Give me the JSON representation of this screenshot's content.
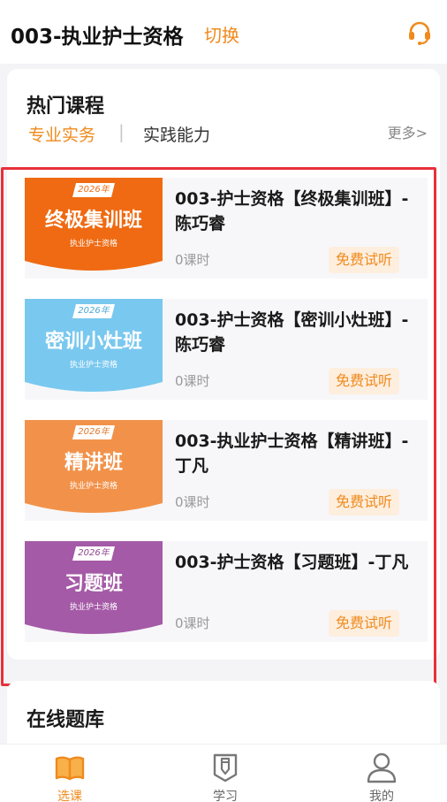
{
  "header": {
    "title": "003-执业护士资格",
    "switch_label": "切换",
    "support_icon": "headset-icon"
  },
  "hot_courses": {
    "title": "热门课程",
    "tabs": [
      {
        "label": "专业实务",
        "active": true
      },
      {
        "label": "实践能力",
        "active": false
      }
    ],
    "separator": "|",
    "more_label": "更多>",
    "courses": [
      {
        "name": "003-护士资格【终极集训班】-陈巧睿",
        "lessons": "0课时",
        "trial": "免费试听",
        "cover_year": "2026年",
        "cover_title": "终极集训班",
        "cover_subtitle": "执业护士资格",
        "cover_color": "#ef6a12"
      },
      {
        "name": "003-护士资格【密训小灶班】-陈巧睿",
        "lessons": "0课时",
        "trial": "免费试听",
        "cover_year": "2026年",
        "cover_title": "密训小灶班",
        "cover_subtitle": "执业护士资格",
        "cover_color": "#79c8ef"
      },
      {
        "name": "003-执业护士资格【精讲班】-丁凡",
        "lessons": "0课时",
        "trial": "免费试听",
        "cover_year": "2026年",
        "cover_title": "精讲班",
        "cover_subtitle": "执业护士资格",
        "cover_color": "#f2924a"
      },
      {
        "name": "003-护士资格【习题班】-丁凡",
        "lessons": "0课时",
        "trial": "免费试听",
        "cover_year": "2026年",
        "cover_title": "习题班",
        "cover_subtitle": "执业护士资格",
        "cover_color": "#a45aa6"
      }
    ]
  },
  "question_bank": {
    "title": "在线题库"
  },
  "tabbar": {
    "items": [
      {
        "label": "选课",
        "icon": "book-open-icon",
        "active": true
      },
      {
        "label": "学习",
        "icon": "pencil-badge-icon",
        "active": false
      },
      {
        "label": "我的",
        "icon": "user-icon",
        "active": false
      }
    ]
  },
  "colors": {
    "accent": "#f08a1c",
    "highlight_border": "#e8303a"
  }
}
